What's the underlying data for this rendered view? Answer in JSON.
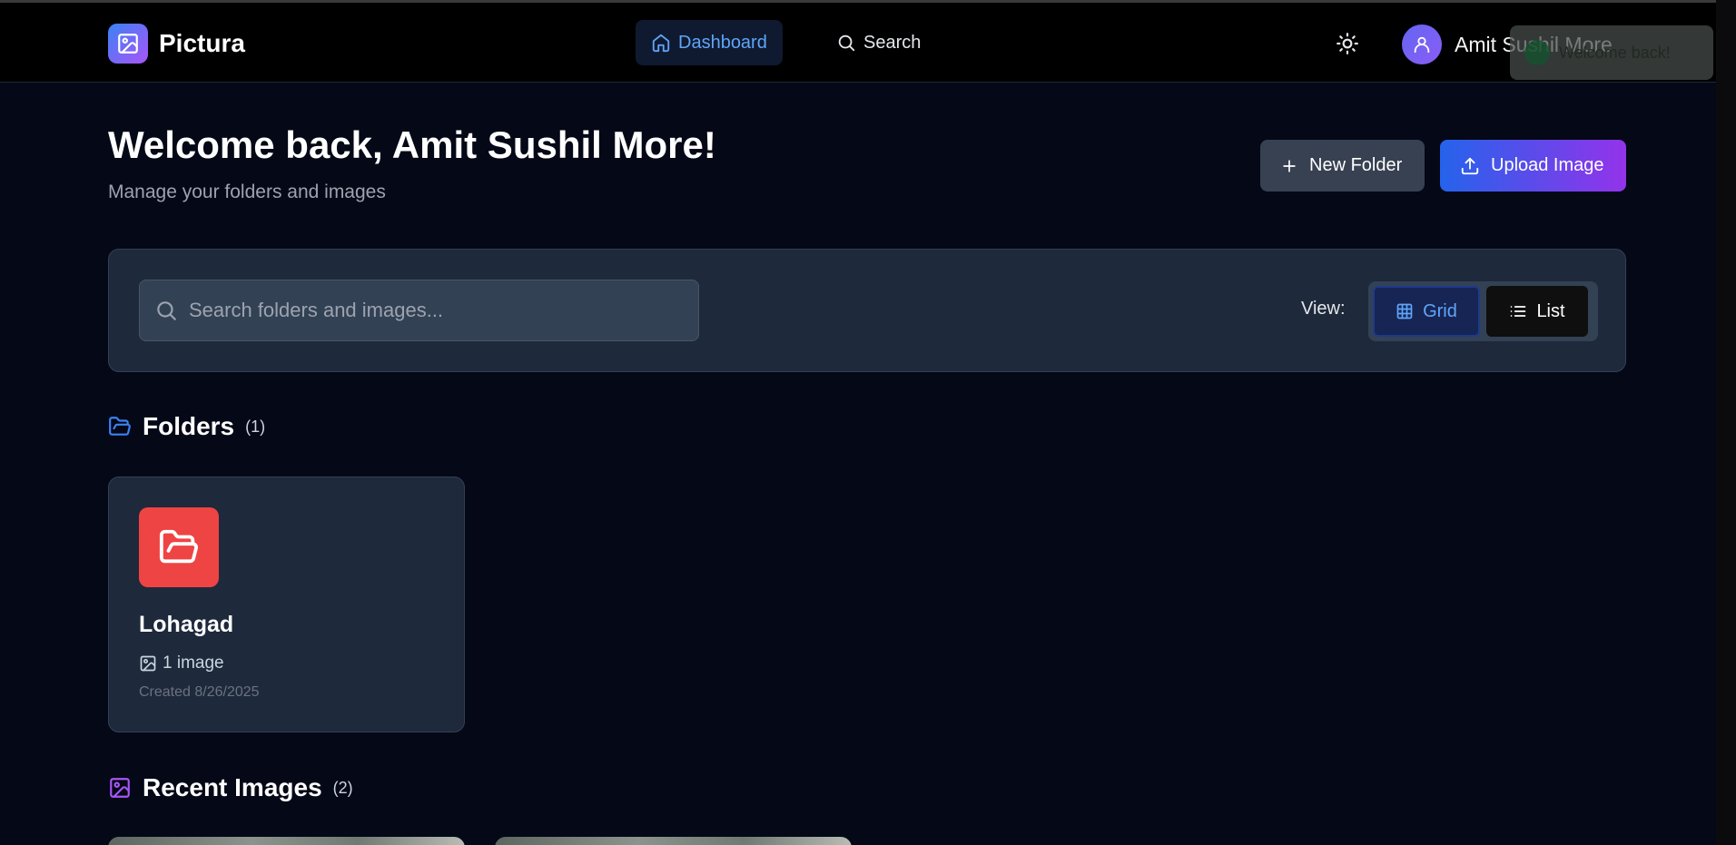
{
  "app": {
    "name": "Pictura"
  },
  "nav": {
    "dashboard_label": "Dashboard",
    "search_label": "Search"
  },
  "user": {
    "name": "Amit Sushil More"
  },
  "toast": {
    "message": "Welcome back!"
  },
  "page": {
    "title": "Welcome back, Amit Sushil More!",
    "subtitle": "Manage your folders and images"
  },
  "actions": {
    "new_folder_label": "New Folder",
    "upload_label": "Upload Image"
  },
  "search": {
    "placeholder": "Search folders and images..."
  },
  "view": {
    "label": "View:",
    "grid_label": "Grid",
    "list_label": "List",
    "selected": "Grid"
  },
  "folders_section": {
    "title": "Folders",
    "count": "(1)"
  },
  "folders": [
    {
      "name": "Lohagad",
      "image_count": "1 image",
      "created": "Created 8/26/2025",
      "color": "#ef4444"
    }
  ],
  "recent_section": {
    "title": "Recent Images",
    "count": "(2)"
  },
  "colors": {
    "accent_blue": "#3b82f6",
    "accent_purple": "#a855f7",
    "background": "#050816",
    "panel": "#1e293b"
  }
}
